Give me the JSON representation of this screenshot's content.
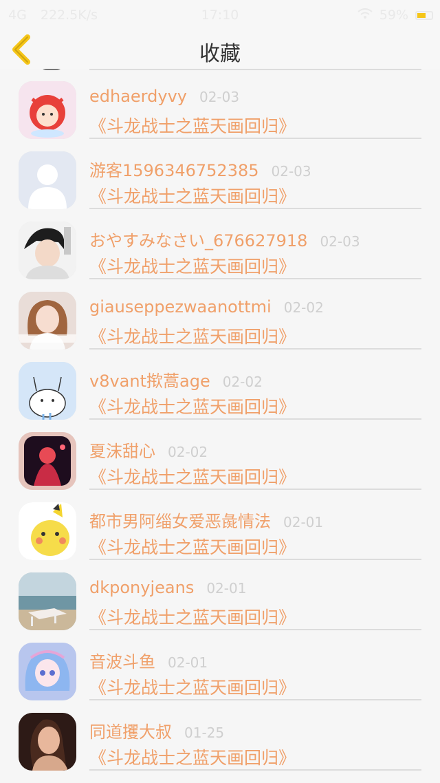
{
  "status_bar": {
    "network": "4G",
    "speed": "222.5K/s",
    "time": "17:10",
    "battery": "59%",
    "battery_level": 0.59
  },
  "header": {
    "title": "收藏",
    "back_icon": "chevron-left-icon"
  },
  "colors": {
    "accent": "#f0a06a",
    "date": "#cfcfcf",
    "back": "#f5c518"
  },
  "items": [
    {
      "name": "edhaerdyvy",
      "date": "02-03",
      "book": "《斗龙战士之蓝天画回归》"
    },
    {
      "name": "游客1596346752385",
      "date": "02-03",
      "book": "《斗龙战士之蓝天画回归》"
    },
    {
      "name": "おやすみなさい_676627918",
      "date": "02-03",
      "book": "《斗龙战士之蓝天画回归》"
    },
    {
      "name": "giauseppezwaanottmi",
      "date": "02-02",
      "book": "《斗龙战士之蓝天画回归》"
    },
    {
      "name": "v8vant揿蒿age",
      "date": "02-02",
      "book": "《斗龙战士之蓝天画回归》"
    },
    {
      "name": "夏沫甜心",
      "date": "02-02",
      "book": "《斗龙战士之蓝天画回归》"
    },
    {
      "name": "都市男阿缁女爱恶彘情法",
      "date": "02-01",
      "book": "《斗龙战士之蓝天画回归》"
    },
    {
      "name": "dkponyjeans",
      "date": "02-01",
      "book": "《斗龙战士之蓝天画回归》"
    },
    {
      "name": "音波斗鱼",
      "date": "02-01",
      "book": "《斗龙战士之蓝天画回归》"
    },
    {
      "name": "同道攫大叔",
      "date": "01-25",
      "book": "《斗龙战士之蓝天画回归》"
    }
  ]
}
